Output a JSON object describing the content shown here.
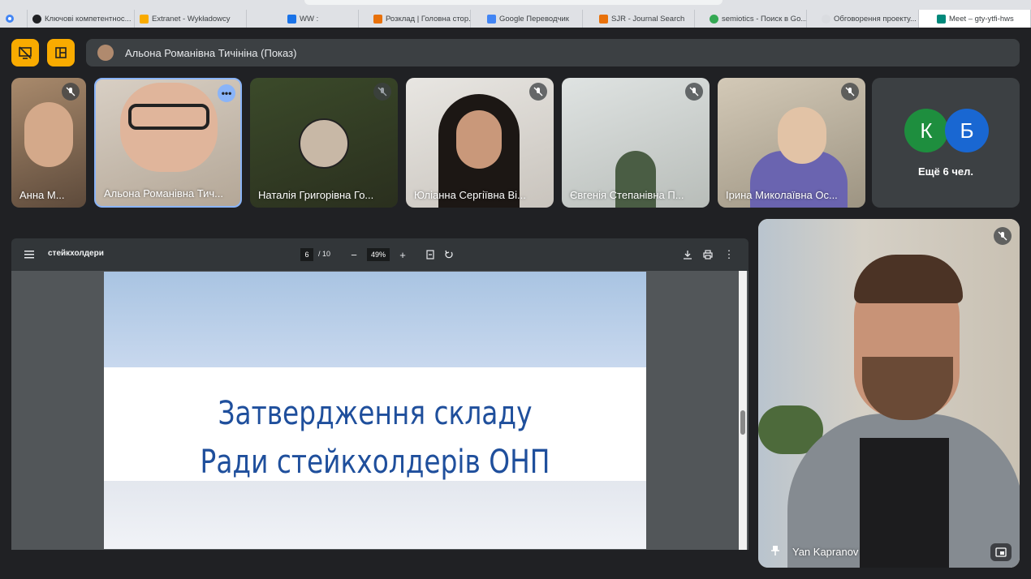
{
  "browser": {
    "tabs": [
      {
        "label": "Ключові компетентнос...",
        "fav": "#202124"
      },
      {
        "label": "Extranet - Wykładowcy",
        "fav": "#f9ab00"
      },
      {
        "label": "WW :",
        "fav": "#1a73e8"
      },
      {
        "label": "Розклад | Головна стор...",
        "fav": "#e8710a"
      },
      {
        "label": "Google Переводчик",
        "fav": "#4285f4"
      },
      {
        "label": "SJR - Journal Search",
        "fav": "#e8710a"
      },
      {
        "label": "semiotics - Поиск в Go...",
        "fav": "#34a853"
      },
      {
        "label": "Обговорення проекту...",
        "fav": "#dadce0"
      },
      {
        "label": "Meet – gty-ytfi-hws",
        "fav": "#00897b"
      }
    ]
  },
  "meet": {
    "presenter_label": "Альона Романівна Тичініна (Показ)",
    "participants": [
      {
        "name": "Анна М..."
      },
      {
        "name": "Альона Романівна Тич..."
      },
      {
        "name": "Наталія Григорівна Го..."
      },
      {
        "name": "Юліанна Сергіївна Ві..."
      },
      {
        "name": "Євгенія Степанівна П..."
      },
      {
        "name": "Ірина Миколаївна Ос..."
      }
    ],
    "more_avatars": [
      "К",
      "Б"
    ],
    "more_label": "Ещё 6 чел.",
    "pinned_name": "Yan Kapranov"
  },
  "pdf": {
    "title": "стейкхолдери",
    "current_page": "6",
    "page_count": "/ 10",
    "zoom": "49%",
    "slide_line1": "Затвердження складу",
    "slide_line2": "Ради стейкхолдерів ОНП"
  },
  "colors": {
    "accent_yellow": "#f9ab00",
    "active_speaker": "#8ab4f8",
    "slide_text": "#1f4f9c",
    "avatar_k": "#1e8e3e",
    "avatar_b": "#1967d2"
  }
}
